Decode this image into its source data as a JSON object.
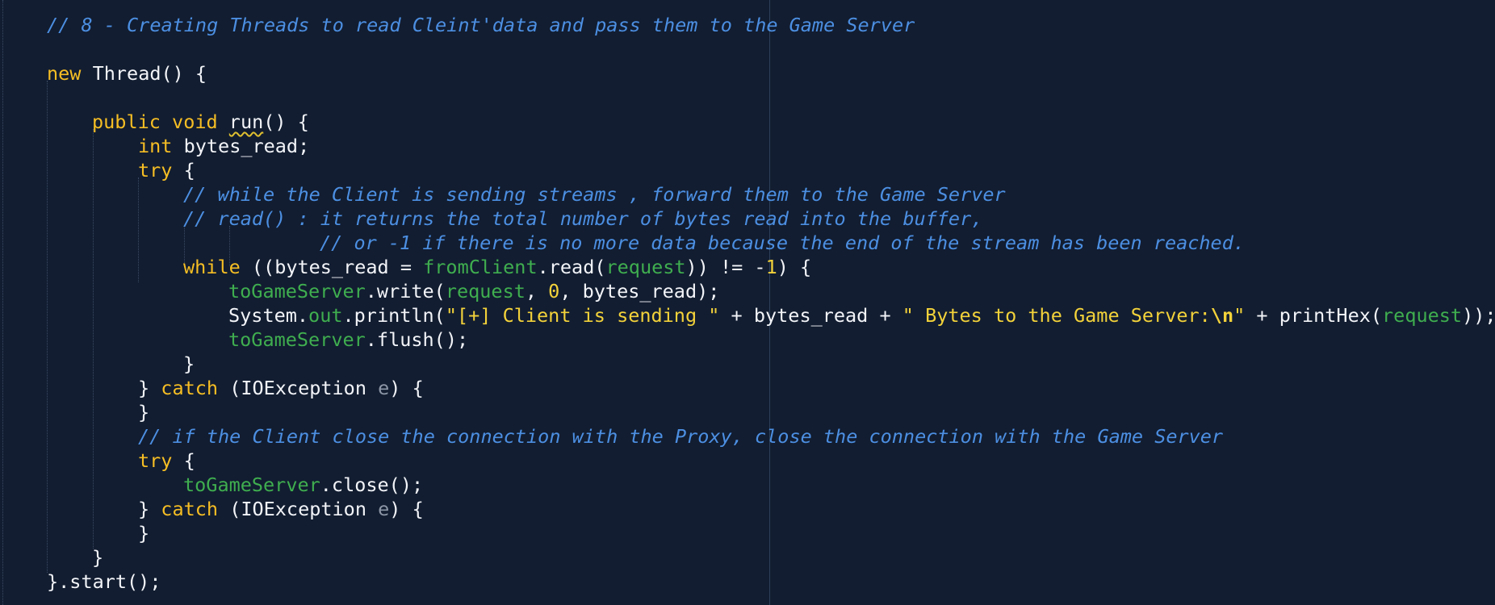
{
  "lines": {
    "l1": {
      "comment": "// 8 - Creating Threads to read Cleint'data and pass them to the Game Server"
    },
    "l2": {
      "kw_new": "new",
      "rest": " Thread() {"
    },
    "l3": {
      "kw_public": "public",
      "kw_void": "void",
      "method": "run",
      "rest": "() {"
    },
    "l4": {
      "kw_int": "int",
      "rest": " bytes_read;"
    },
    "l5": {
      "kw_try": "try",
      "rest": " {"
    },
    "l6": {
      "comment": "// while the Client is sending streams , forward them to the Game Server"
    },
    "l7": {
      "comment": "// read() : it returns the total number of bytes read into the buffer,"
    },
    "l8": {
      "comment": "// or -1 if there is no more data because the end of the stream has been reached."
    },
    "l9": {
      "kw_while": "while",
      "p1": " ((bytes_read = ",
      "field1": "fromClient",
      "p2": ".read(",
      "field2": "request",
      "p3": ")) != -",
      "num": "1",
      "p4": ") {"
    },
    "l10": {
      "field1": "toGameServer",
      "p1": ".write(",
      "field2": "request",
      "p2": ", ",
      "num": "0",
      "p3": ", bytes_read);"
    },
    "l11": {
      "p1": "System.",
      "field1": "out",
      "p2": ".println(",
      "str1": "\"[+] Client is sending \"",
      "p3": " + bytes_read + ",
      "str2": "\" Bytes to the Game Server:",
      "esc": "\\n",
      "str3": "\"",
      "p4": " + printHex(",
      "field2": "request",
      "p5": "));"
    },
    "l12": {
      "field1": "toGameServer",
      "rest": ".flush();"
    },
    "l13": {
      "rest": "}"
    },
    "l14": {
      "p1": "} ",
      "kw_catch": "catch",
      "p2": " (IOException ",
      "var": "e",
      "p3": ") {"
    },
    "l15": {
      "rest": "}"
    },
    "l16": {
      "comment": "// if the Client close the connection with the Proxy, close the connection with the Game Server"
    },
    "l17": {
      "kw_try": "try",
      "rest": " {"
    },
    "l18": {
      "field1": "toGameServer",
      "rest": ".close();"
    },
    "l19": {
      "p1": "} ",
      "kw_catch": "catch",
      "p2": " (IOException ",
      "var": "e",
      "p3": ") {"
    },
    "l20": {
      "rest": "}"
    },
    "l21": {
      "rest": "}"
    },
    "l22": {
      "rest": "}.start();"
    }
  },
  "colors": {
    "background": "#121d31",
    "keyword": "#f6be24",
    "comment": "#4c8fe2",
    "field": "#3fae4f",
    "string": "#f3d23a",
    "plain": "#f2f4f8"
  }
}
